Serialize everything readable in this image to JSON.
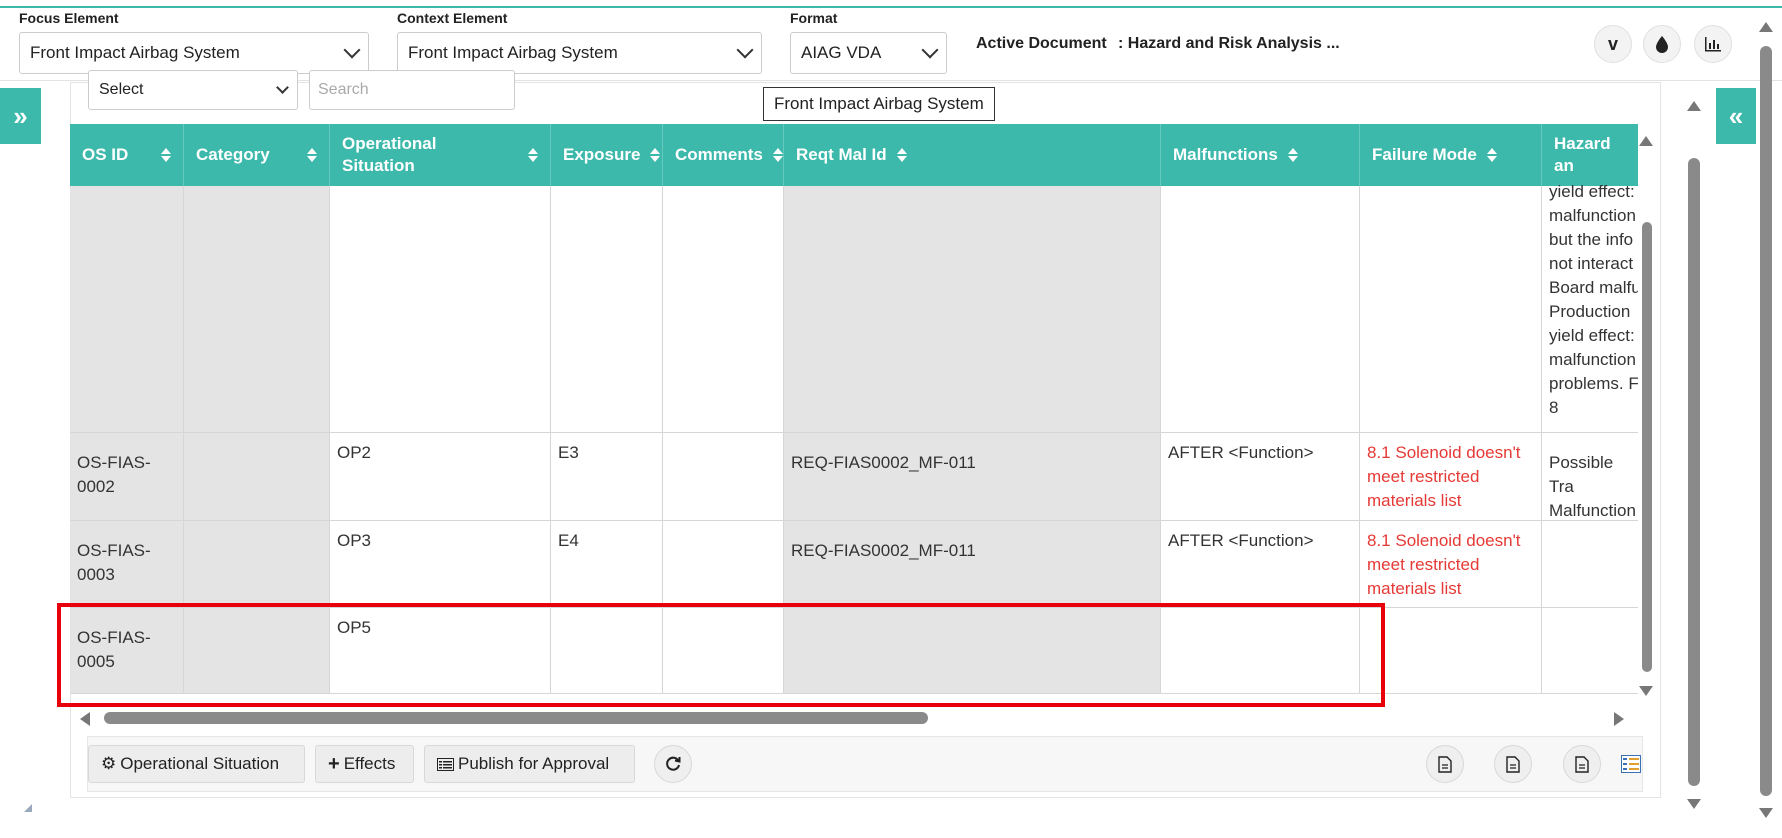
{
  "header": {
    "focus_label": "Focus Element",
    "focus_value": "Front Impact Airbag System",
    "context_label": "Context Element",
    "context_value": "Front Impact Airbag System",
    "format_label": "Format",
    "format_value": "AIAG VDA",
    "active_doc_label": "Active Document",
    "active_doc_value": ": Hazard and Risk Analysis ...",
    "icons": [
      "vine-icon",
      "drop-icon",
      "bar-chart-icon"
    ]
  },
  "filters": {
    "select_value": "Select",
    "search_placeholder": "Search"
  },
  "tooltip": "Front Impact Airbag System",
  "table": {
    "columns": [
      "OS ID",
      "Category",
      "Operational Situation",
      "Exposure",
      "Comments",
      "Reqt Mal Id",
      "Malfunctions",
      "Failure Mode",
      "Hazard an"
    ],
    "top_row_hazard_lines": [
      "yield effect:",
      "malfunction",
      "but the info",
      "not interact",
      "Board malfu",
      "Production",
      "yield effect:",
      "malfunction",
      "problems. F",
      "8"
    ],
    "rows": [
      {
        "os_id": "OS-FIAS-0002",
        "category": "",
        "op_situation": "OP2",
        "exposure": "E3",
        "comments": "",
        "reqt_mal_id": "REQ-FIAS0002_MF-011",
        "malfunctions": "AFTER <Function>",
        "failure_mode": "8.1 Solenoid doesn't meet restricted materials list",
        "hazard": "Possible Tra Malfunction"
      },
      {
        "os_id": "OS-FIAS-0003",
        "category": "",
        "op_situation": "OP3",
        "exposure": "E4",
        "comments": "",
        "reqt_mal_id": "REQ-FIAS0002_MF-011",
        "malfunctions": "AFTER <Function>",
        "failure_mode": "8.1 Solenoid doesn't meet restricted materials list",
        "hazard": ""
      },
      {
        "os_id": "OS-FIAS-0005",
        "category": "",
        "op_situation": "OP5",
        "exposure": "",
        "comments": "",
        "reqt_mal_id": "",
        "malfunctions": "",
        "failure_mode": "",
        "hazard": ""
      }
    ]
  },
  "footer": {
    "op_situation_label": "Operational Situation",
    "effects_label": "Effects",
    "publish_label": "Publish for Approval"
  },
  "colors": {
    "accent": "#3cb9ab",
    "highlight": "#e8000b",
    "error_text": "#e53935"
  }
}
